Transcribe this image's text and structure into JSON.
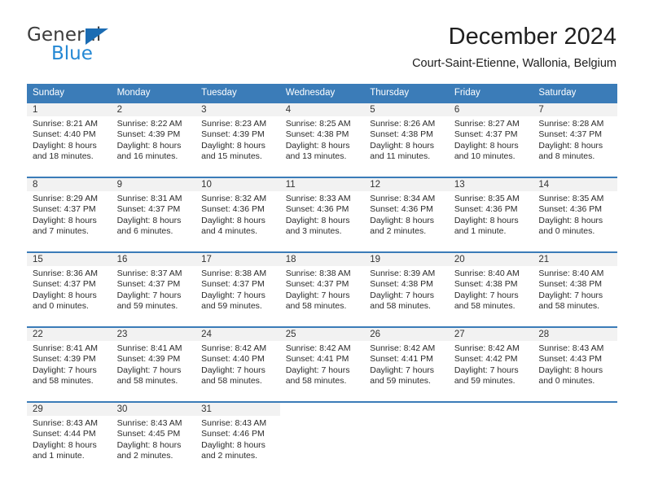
{
  "brand": {
    "name_top": "General",
    "name_bottom": "Blue",
    "triangle_color": "#1b6cb3",
    "blue_color": "#2488d4"
  },
  "header": {
    "title": "December 2024",
    "subtitle": "Court-Saint-Etienne, Wallonia, Belgium"
  },
  "theme": {
    "header_bg": "#3b7cb8",
    "daynum_bg": "#f2f2f2",
    "text": "#2b2b2b"
  },
  "weekdays": [
    "Sunday",
    "Monday",
    "Tuesday",
    "Wednesday",
    "Thursday",
    "Friday",
    "Saturday"
  ],
  "weeks": [
    [
      {
        "day": "1",
        "sunrise": "Sunrise: 8:21 AM",
        "sunset": "Sunset: 4:40 PM",
        "daylight1": "Daylight: 8 hours",
        "daylight2": "and 18 minutes."
      },
      {
        "day": "2",
        "sunrise": "Sunrise: 8:22 AM",
        "sunset": "Sunset: 4:39 PM",
        "daylight1": "Daylight: 8 hours",
        "daylight2": "and 16 minutes."
      },
      {
        "day": "3",
        "sunrise": "Sunrise: 8:23 AM",
        "sunset": "Sunset: 4:39 PM",
        "daylight1": "Daylight: 8 hours",
        "daylight2": "and 15 minutes."
      },
      {
        "day": "4",
        "sunrise": "Sunrise: 8:25 AM",
        "sunset": "Sunset: 4:38 PM",
        "daylight1": "Daylight: 8 hours",
        "daylight2": "and 13 minutes."
      },
      {
        "day": "5",
        "sunrise": "Sunrise: 8:26 AM",
        "sunset": "Sunset: 4:38 PM",
        "daylight1": "Daylight: 8 hours",
        "daylight2": "and 11 minutes."
      },
      {
        "day": "6",
        "sunrise": "Sunrise: 8:27 AM",
        "sunset": "Sunset: 4:37 PM",
        "daylight1": "Daylight: 8 hours",
        "daylight2": "and 10 minutes."
      },
      {
        "day": "7",
        "sunrise": "Sunrise: 8:28 AM",
        "sunset": "Sunset: 4:37 PM",
        "daylight1": "Daylight: 8 hours",
        "daylight2": "and 8 minutes."
      }
    ],
    [
      {
        "day": "8",
        "sunrise": "Sunrise: 8:29 AM",
        "sunset": "Sunset: 4:37 PM",
        "daylight1": "Daylight: 8 hours",
        "daylight2": "and 7 minutes."
      },
      {
        "day": "9",
        "sunrise": "Sunrise: 8:31 AM",
        "sunset": "Sunset: 4:37 PM",
        "daylight1": "Daylight: 8 hours",
        "daylight2": "and 6 minutes."
      },
      {
        "day": "10",
        "sunrise": "Sunrise: 8:32 AM",
        "sunset": "Sunset: 4:36 PM",
        "daylight1": "Daylight: 8 hours",
        "daylight2": "and 4 minutes."
      },
      {
        "day": "11",
        "sunrise": "Sunrise: 8:33 AM",
        "sunset": "Sunset: 4:36 PM",
        "daylight1": "Daylight: 8 hours",
        "daylight2": "and 3 minutes."
      },
      {
        "day": "12",
        "sunrise": "Sunrise: 8:34 AM",
        "sunset": "Sunset: 4:36 PM",
        "daylight1": "Daylight: 8 hours",
        "daylight2": "and 2 minutes."
      },
      {
        "day": "13",
        "sunrise": "Sunrise: 8:35 AM",
        "sunset": "Sunset: 4:36 PM",
        "daylight1": "Daylight: 8 hours",
        "daylight2": "and 1 minute."
      },
      {
        "day": "14",
        "sunrise": "Sunrise: 8:35 AM",
        "sunset": "Sunset: 4:36 PM",
        "daylight1": "Daylight: 8 hours",
        "daylight2": "and 0 minutes."
      }
    ],
    [
      {
        "day": "15",
        "sunrise": "Sunrise: 8:36 AM",
        "sunset": "Sunset: 4:37 PM",
        "daylight1": "Daylight: 8 hours",
        "daylight2": "and 0 minutes."
      },
      {
        "day": "16",
        "sunrise": "Sunrise: 8:37 AM",
        "sunset": "Sunset: 4:37 PM",
        "daylight1": "Daylight: 7 hours",
        "daylight2": "and 59 minutes."
      },
      {
        "day": "17",
        "sunrise": "Sunrise: 8:38 AM",
        "sunset": "Sunset: 4:37 PM",
        "daylight1": "Daylight: 7 hours",
        "daylight2": "and 59 minutes."
      },
      {
        "day": "18",
        "sunrise": "Sunrise: 8:38 AM",
        "sunset": "Sunset: 4:37 PM",
        "daylight1": "Daylight: 7 hours",
        "daylight2": "and 58 minutes."
      },
      {
        "day": "19",
        "sunrise": "Sunrise: 8:39 AM",
        "sunset": "Sunset: 4:38 PM",
        "daylight1": "Daylight: 7 hours",
        "daylight2": "and 58 minutes."
      },
      {
        "day": "20",
        "sunrise": "Sunrise: 8:40 AM",
        "sunset": "Sunset: 4:38 PM",
        "daylight1": "Daylight: 7 hours",
        "daylight2": "and 58 minutes."
      },
      {
        "day": "21",
        "sunrise": "Sunrise: 8:40 AM",
        "sunset": "Sunset: 4:38 PM",
        "daylight1": "Daylight: 7 hours",
        "daylight2": "and 58 minutes."
      }
    ],
    [
      {
        "day": "22",
        "sunrise": "Sunrise: 8:41 AM",
        "sunset": "Sunset: 4:39 PM",
        "daylight1": "Daylight: 7 hours",
        "daylight2": "and 58 minutes."
      },
      {
        "day": "23",
        "sunrise": "Sunrise: 8:41 AM",
        "sunset": "Sunset: 4:39 PM",
        "daylight1": "Daylight: 7 hours",
        "daylight2": "and 58 minutes."
      },
      {
        "day": "24",
        "sunrise": "Sunrise: 8:42 AM",
        "sunset": "Sunset: 4:40 PM",
        "daylight1": "Daylight: 7 hours",
        "daylight2": "and 58 minutes."
      },
      {
        "day": "25",
        "sunrise": "Sunrise: 8:42 AM",
        "sunset": "Sunset: 4:41 PM",
        "daylight1": "Daylight: 7 hours",
        "daylight2": "and 58 minutes."
      },
      {
        "day": "26",
        "sunrise": "Sunrise: 8:42 AM",
        "sunset": "Sunset: 4:41 PM",
        "daylight1": "Daylight: 7 hours",
        "daylight2": "and 59 minutes."
      },
      {
        "day": "27",
        "sunrise": "Sunrise: 8:42 AM",
        "sunset": "Sunset: 4:42 PM",
        "daylight1": "Daylight: 7 hours",
        "daylight2": "and 59 minutes."
      },
      {
        "day": "28",
        "sunrise": "Sunrise: 8:43 AM",
        "sunset": "Sunset: 4:43 PM",
        "daylight1": "Daylight: 8 hours",
        "daylight2": "and 0 minutes."
      }
    ],
    [
      {
        "day": "29",
        "sunrise": "Sunrise: 8:43 AM",
        "sunset": "Sunset: 4:44 PM",
        "daylight1": "Daylight: 8 hours",
        "daylight2": "and 1 minute."
      },
      {
        "day": "30",
        "sunrise": "Sunrise: 8:43 AM",
        "sunset": "Sunset: 4:45 PM",
        "daylight1": "Daylight: 8 hours",
        "daylight2": "and 2 minutes."
      },
      {
        "day": "31",
        "sunrise": "Sunrise: 8:43 AM",
        "sunset": "Sunset: 4:46 PM",
        "daylight1": "Daylight: 8 hours",
        "daylight2": "and 2 minutes."
      },
      {
        "day": "",
        "sunrise": "",
        "sunset": "",
        "daylight1": "",
        "daylight2": ""
      },
      {
        "day": "",
        "sunrise": "",
        "sunset": "",
        "daylight1": "",
        "daylight2": ""
      },
      {
        "day": "",
        "sunrise": "",
        "sunset": "",
        "daylight1": "",
        "daylight2": ""
      },
      {
        "day": "",
        "sunrise": "",
        "sunset": "",
        "daylight1": "",
        "daylight2": ""
      }
    ]
  ]
}
